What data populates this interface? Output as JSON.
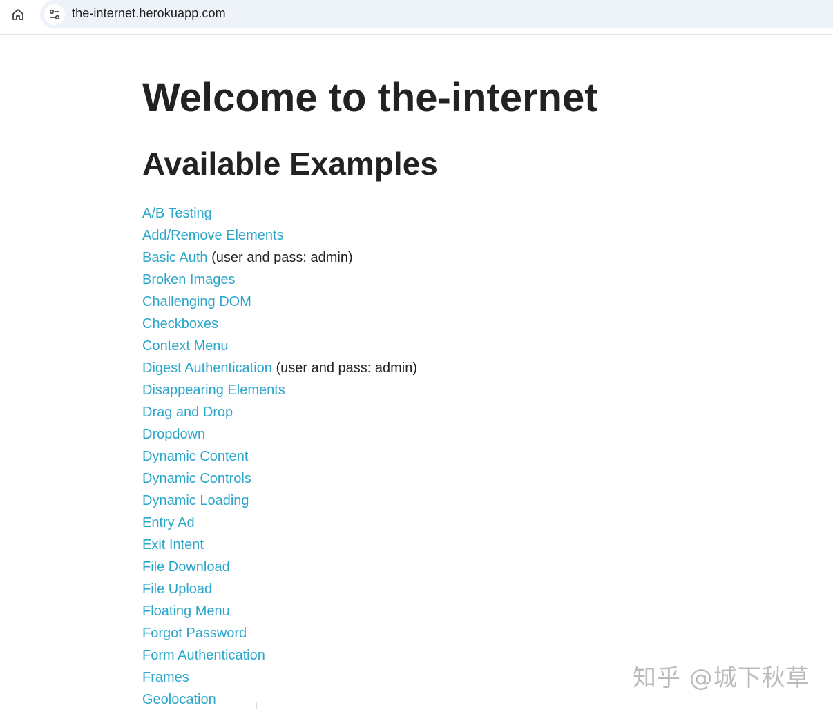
{
  "browser": {
    "url": "the-internet.herokuapp.com",
    "home_icon": "home-icon",
    "site_info_icon": "tune-icon"
  },
  "page": {
    "title": "Welcome to the-internet",
    "subtitle": "Available Examples",
    "link_color": "#2ba6cb",
    "text_color": "#222222",
    "examples": [
      {
        "label": "A/B Testing",
        "note": ""
      },
      {
        "label": "Add/Remove Elements",
        "note": ""
      },
      {
        "label": "Basic Auth",
        "note": " (user and pass: admin)"
      },
      {
        "label": "Broken Images",
        "note": ""
      },
      {
        "label": "Challenging DOM",
        "note": ""
      },
      {
        "label": "Checkboxes",
        "note": ""
      },
      {
        "label": "Context Menu",
        "note": ""
      },
      {
        "label": "Digest Authentication",
        "note": " (user and pass: admin)"
      },
      {
        "label": "Disappearing Elements",
        "note": ""
      },
      {
        "label": "Drag and Drop",
        "note": ""
      },
      {
        "label": "Dropdown",
        "note": ""
      },
      {
        "label": "Dynamic Content",
        "note": ""
      },
      {
        "label": "Dynamic Controls",
        "note": ""
      },
      {
        "label": "Dynamic Loading",
        "note": ""
      },
      {
        "label": "Entry Ad",
        "note": ""
      },
      {
        "label": "Exit Intent",
        "note": ""
      },
      {
        "label": "File Download",
        "note": ""
      },
      {
        "label": "File Upload",
        "note": ""
      },
      {
        "label": "Floating Menu",
        "note": ""
      },
      {
        "label": "Forgot Password",
        "note": ""
      },
      {
        "label": "Form Authentication",
        "note": ""
      },
      {
        "label": "Frames",
        "note": ""
      },
      {
        "label": "Geolocation",
        "note": ""
      }
    ]
  },
  "watermark": "知乎 @城下秋草"
}
